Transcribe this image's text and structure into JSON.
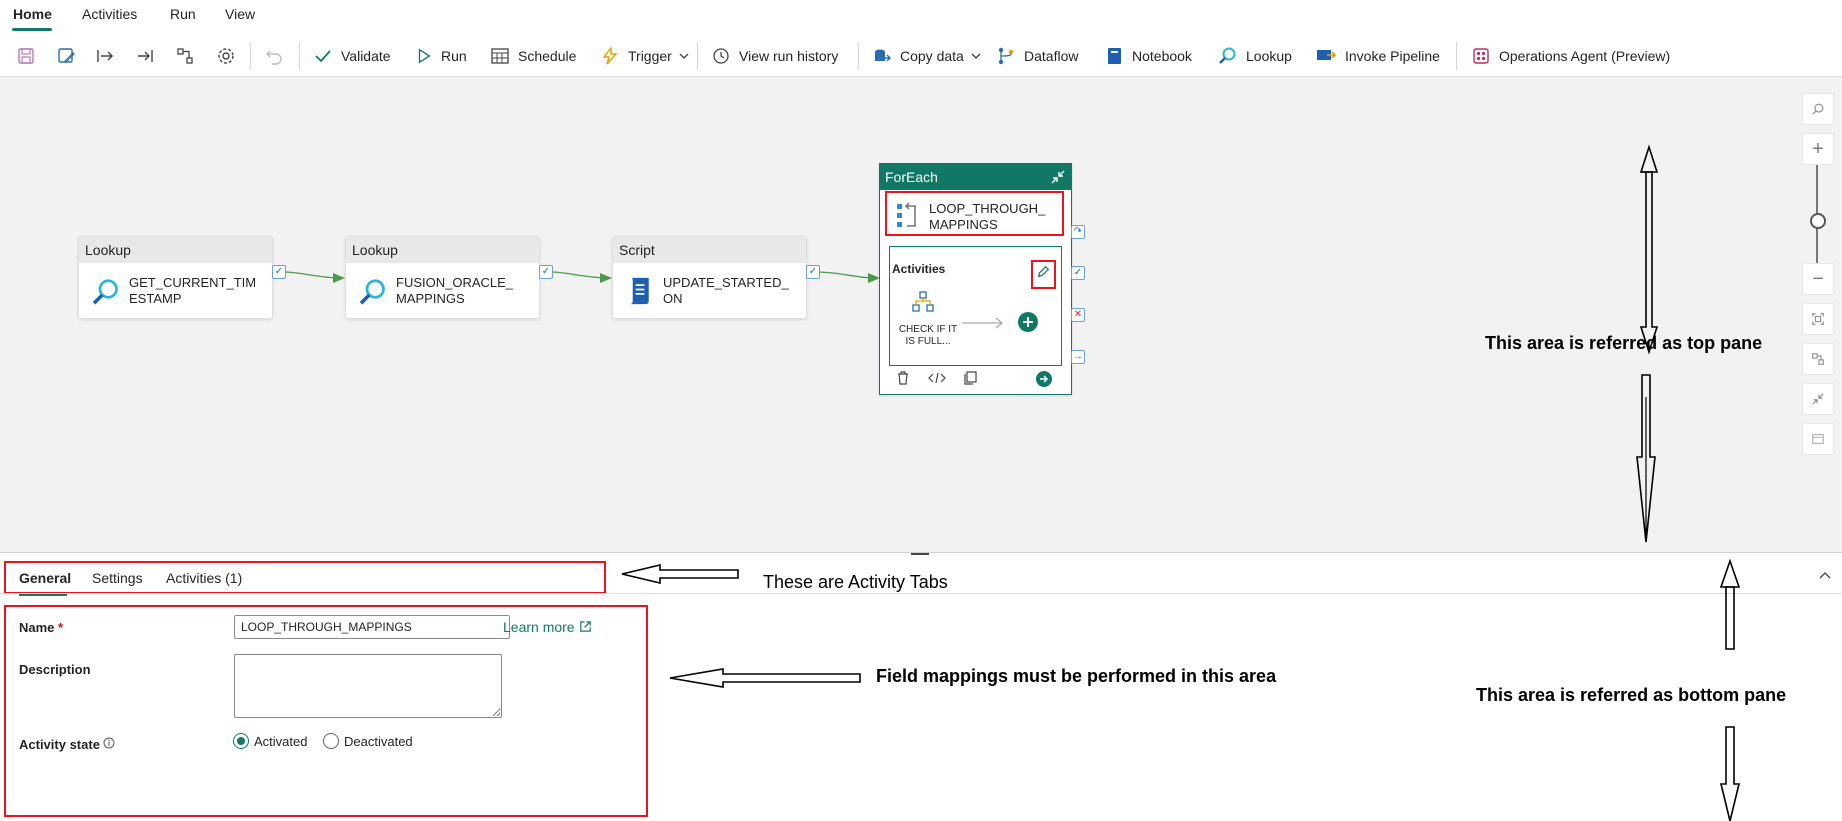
{
  "menu": {
    "tabs": [
      {
        "label": "Home"
      },
      {
        "label": "Activities"
      },
      {
        "label": "Run"
      },
      {
        "label": "View"
      }
    ]
  },
  "toolbar": {
    "validate": "Validate",
    "run": "Run",
    "schedule": "Schedule",
    "trigger": "Trigger",
    "view_run_history": "View run history",
    "copy_data": "Copy data",
    "dataflow": "Dataflow",
    "notebook": "Notebook",
    "lookup": "Lookup",
    "invoke_pipeline": "Invoke Pipeline",
    "operations_agent": "Operations Agent (Preview)"
  },
  "canvas": {
    "nodes": [
      {
        "type": "Lookup",
        "name": "GET_CURRENT_TIM ESTAMP",
        "icon": "lookup-icon"
      },
      {
        "type": "Lookup",
        "name": "FUSION_ORACLE_ MAPPINGS",
        "icon": "lookup-icon"
      },
      {
        "type": "Script",
        "name": "UPDATE_STARTED_ ON",
        "icon": "script-icon"
      }
    ],
    "foreach": {
      "type": "ForEach",
      "name": "LOOP_THROUGH_ MAPPINGS",
      "activities_label": "Activities",
      "inner_activity": "CHECK IF IT IS FULL..."
    }
  },
  "bottom": {
    "tabs": [
      {
        "label": "General"
      },
      {
        "label": "Settings"
      },
      {
        "label": "Activities (1)"
      }
    ],
    "name_label": "Name",
    "required_mark": "*",
    "name_value": "LOOP_THROUGH_MAPPINGS",
    "learn_more": "Learn more",
    "description_label": "Description",
    "description_value": "",
    "activity_state_label": "Activity state",
    "activated": "Activated",
    "deactivated": "Deactivated"
  },
  "annotations": {
    "top_pane": "This area is referred as top pane",
    "activity_tabs": "These are Activity Tabs",
    "field_mappings": "Field mappings must be performed in this area",
    "bottom_pane": "This area is referred as bottom pane"
  },
  "colors": {
    "accent": "#117865",
    "highlight_red": "#e8141f",
    "canvas_bg": "#f2f2f2"
  }
}
